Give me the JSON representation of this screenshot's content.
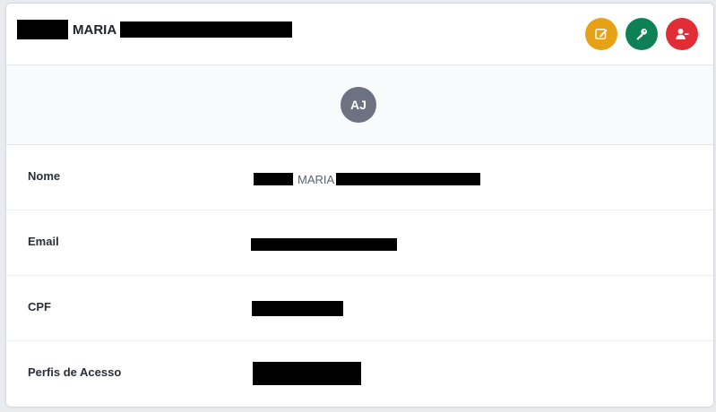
{
  "header": {
    "name_visible": "MARIA",
    "actions": [
      {
        "name": "edit-button",
        "icon": "edit-icon",
        "color": "#e6a117"
      },
      {
        "name": "change-password-button",
        "icon": "key-icon",
        "color": "#0e8055"
      },
      {
        "name": "remove-user-button",
        "icon": "user-minus-icon",
        "color": "#e12d35"
      }
    ]
  },
  "avatar": {
    "initials": "AJ",
    "color": "#6c7281"
  },
  "fields": [
    {
      "label": "Nome",
      "value_visible": "MARIA"
    },
    {
      "label": "Email",
      "value_visible": ""
    },
    {
      "label": "CPF",
      "value_visible": ""
    },
    {
      "label": "Perfis de Acesso",
      "value_visible": ""
    }
  ]
}
